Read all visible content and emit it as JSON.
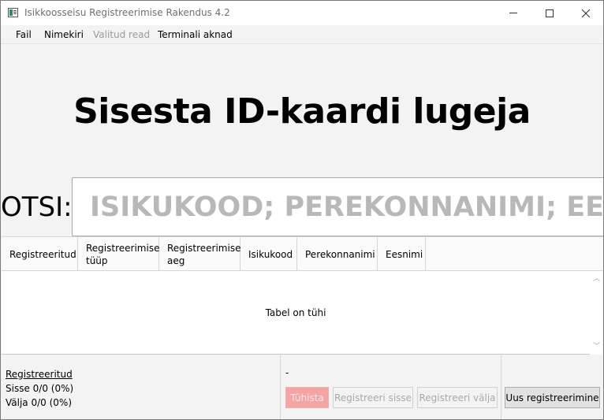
{
  "window": {
    "title": "Isikkoosseisu Registreerimise Rakendus 4.2",
    "close_glyph": "✕"
  },
  "menu": [
    "Fail",
    "Nimekiri",
    "Valitud read",
    "Terminali aknad"
  ],
  "heading": "Sisesta ID-kaardi lugeja",
  "search": {
    "label": "OTSI:",
    "placeholder": "ISIKUKOOD; PEREKONNANIMI; EESNIMI"
  },
  "table": {
    "columns": [
      "Registreeritud",
      "Registreerimise\ntüüp",
      "Registreerimise\naeg",
      "Isikukood",
      "Perekonnanimi",
      "Eesnimi"
    ],
    "empty_text": "Tabel on tühi"
  },
  "stats": {
    "title": "Registreeritud",
    "in": "Sisse 0/0 (0%)",
    "out": "Välja 0/0 (0%)"
  },
  "selection": "-",
  "buttons": {
    "cancel": "Tühista",
    "register_in": "Registreeri sisse",
    "register_out": "Registreeri välja",
    "new_registration": "Uus registreerimine"
  },
  "colors": {
    "cancel_button": "#f4a4a4",
    "window_background": "#f3f3f3"
  }
}
